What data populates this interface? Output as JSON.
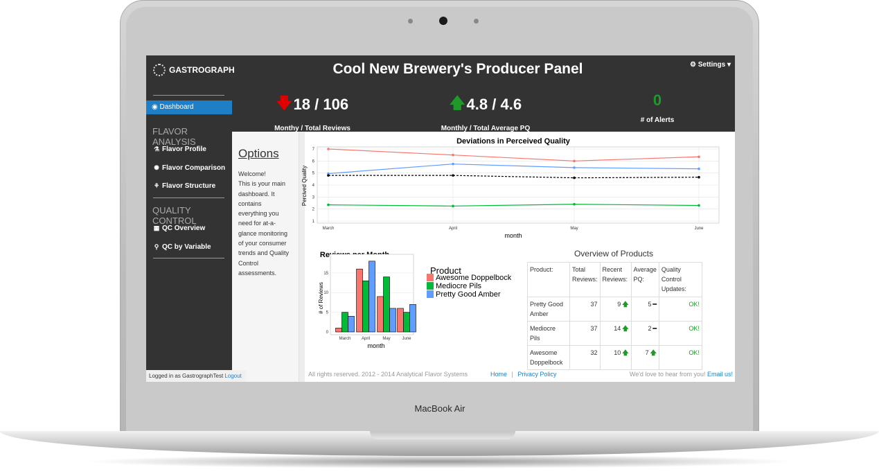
{
  "device": {
    "brand": "MacBook Air"
  },
  "app": {
    "logo": "GASTROGRAPH",
    "title": "Cool New Brewery's Producer Panel",
    "settings": "Settings"
  },
  "kpis": [
    {
      "value": "18 / 106",
      "label": "Monthy / Total Reviews",
      "trend": "down"
    },
    {
      "value": "4.8 / 4.6",
      "label": "Monthly / Total Average PQ",
      "trend": "up"
    },
    {
      "value": "0",
      "label": "# of Alerts",
      "trend": "none"
    }
  ],
  "sidebar": {
    "active": "Dashboard",
    "sections": [
      {
        "title": "FLAVOR ANALYSIS",
        "items": [
          "Flavor Profile",
          "Flavor Comparison",
          "Flavor Structure"
        ]
      },
      {
        "title": "QUALITY CONTROL",
        "items": [
          "QC Overview",
          "QC by Variable"
        ]
      }
    ],
    "login_text": "Logged in as GastrographTest",
    "logout": "Logout"
  },
  "options": {
    "heading": "Options",
    "text_lines": [
      "Welcome!",
      "This is your main",
      "dashboard. It",
      "contains",
      "everything you",
      "need for at-a-",
      "glance monitoring",
      "of your consumer",
      "trends and Quality",
      "Control",
      "assessments."
    ]
  },
  "colors": {
    "series1": "#f8766d",
    "series2": "#00ba38",
    "series3": "#619cff",
    "accent": "#1f7fc6",
    "dark": "#333333"
  },
  "chart_data": [
    {
      "type": "line",
      "title": "Deviations in Perceived Quality",
      "xlabel": "month",
      "ylabel": "Percived Quality",
      "x": [
        "March",
        "April",
        "May",
        "June"
      ],
      "yticks": [
        1,
        2,
        3,
        4,
        5,
        6,
        7
      ],
      "ylim": [
        1,
        7
      ],
      "grid": true,
      "series": [
        {
          "values": [
            7.0,
            6.5,
            6.0,
            6.35
          ],
          "color": "#f8766d"
        },
        {
          "values": [
            4.95,
            5.75,
            5.45,
            5.35
          ],
          "color": "#619cff"
        },
        {
          "values": [
            4.8,
            4.8,
            4.6,
            4.65
          ],
          "color": "#000000",
          "dashed": true
        },
        {
          "values": [
            2.35,
            2.25,
            2.4,
            2.3
          ],
          "color": "#00ba38"
        }
      ]
    },
    {
      "type": "bar",
      "title": "Reviews per Month",
      "xlabel": "month",
      "ylabel": "# of Reviews",
      "categories": [
        "March",
        "April",
        "May",
        "June"
      ],
      "yticks": [
        0,
        5,
        10,
        15
      ],
      "ylim": [
        0,
        18.5
      ],
      "grid": true,
      "legend_title": "Product",
      "legend_position": "right",
      "series": [
        {
          "name": "Awesome Doppelbock",
          "values": [
            1,
            16,
            9,
            6
          ],
          "color": "#f8766d"
        },
        {
          "name": "Mediocre Pils",
          "values": [
            5,
            13,
            14,
            5
          ],
          "color": "#00ba38"
        },
        {
          "name": "Pretty Good Amber",
          "values": [
            4,
            18,
            6,
            7
          ],
          "color": "#619cff"
        }
      ]
    }
  ],
  "products": {
    "title": "Overview of Products",
    "headers": [
      "Product:",
      "Total Reviews:",
      "Recent Reviews:",
      "Average PQ:",
      "Quality Control Updates:"
    ],
    "rows": [
      {
        "product": "Pretty Good Amber",
        "total": "37",
        "recent": "9",
        "recent_trend": "up",
        "avg": "5",
        "avg_trend": "flat",
        "qc": "OK!"
      },
      {
        "product": "Mediocre Pils",
        "total": "37",
        "recent": "14",
        "recent_trend": "up",
        "avg": "2",
        "avg_trend": "flat",
        "qc": "OK!"
      },
      {
        "product": "Awesome Doppelbock",
        "total": "32",
        "recent": "10",
        "recent_trend": "up",
        "avg": "7",
        "avg_trend": "up",
        "qc": "OK!"
      }
    ]
  },
  "footer": {
    "copyright": "All rights reserved. 2012 - 2014 Analytical Flavor Systems",
    "home": "Home",
    "separator": "|",
    "privacy": "Privacy Policy",
    "contact_text": "We'd love to hear from you!",
    "email": "Email us!"
  }
}
